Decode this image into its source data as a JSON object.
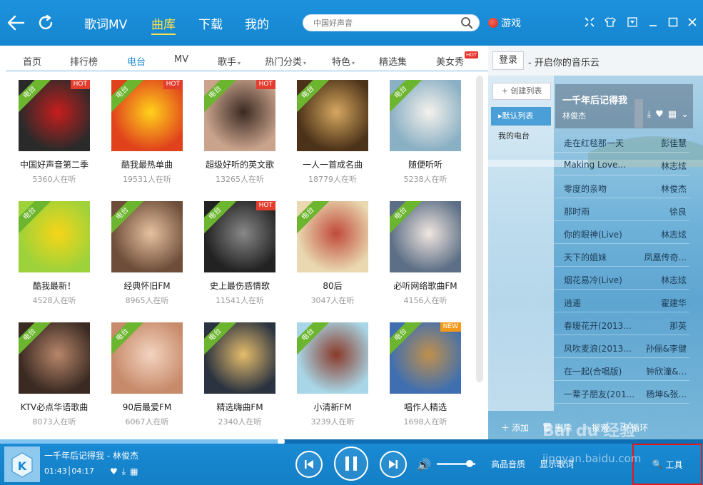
{
  "topbar": {
    "nav": [
      "歌词MV",
      "曲库",
      "下载",
      "我的"
    ],
    "active_nav": "曲库",
    "search_placeholder": "中国好声音",
    "game_label": "游戏"
  },
  "tabs": [
    {
      "label": "首页",
      "dropdown": false
    },
    {
      "label": "排行榜",
      "dropdown": false
    },
    {
      "label": "电台",
      "dropdown": false,
      "active": true
    },
    {
      "label": "MV",
      "dropdown": false
    },
    {
      "label": "歌手",
      "dropdown": true
    },
    {
      "label": "热门分类",
      "dropdown": true
    },
    {
      "label": "特色",
      "dropdown": true
    },
    {
      "label": "精选集",
      "dropdown": false
    },
    {
      "label": "美女秀",
      "dropdown": false,
      "badge": "HOT"
    }
  ],
  "stations": [
    {
      "title": "中国好声音第二季",
      "listeners": "5360人在听",
      "corner": "电台",
      "badge": "HOT",
      "bg": "#2a2a2a",
      "accent": "#c81d1d"
    },
    {
      "title": "酷我最热单曲",
      "listeners": "19531人在听",
      "corner": "电台",
      "badge": "HOT",
      "bg": "#e0421c",
      "accent": "#ffd21b"
    },
    {
      "title": "超级好听的英文歌",
      "listeners": "13265人在听",
      "corner": "电台",
      "badge": "HOT",
      "bg": "#c9a38c",
      "accent": "#3b2a22"
    },
    {
      "title": "一人一首成名曲",
      "listeners": "18779人在听",
      "corner": "电台",
      "badge": "",
      "bg": "#4b3218",
      "accent": "#d6a760"
    },
    {
      "title": "随便听听",
      "listeners": "5238人在听",
      "corner": "电台",
      "badge": "",
      "bg": "#8ab0c4",
      "accent": "#f4f1ec"
    },
    {
      "title": "酷我最新！",
      "listeners": "4528人在听",
      "corner": "电台",
      "badge": "",
      "bg": "#9dd23a",
      "accent": "#f7d518"
    },
    {
      "title": "经典怀旧FM",
      "listeners": "8965人在听",
      "corner": "电台",
      "badge": "",
      "bg": "#6e4e3a",
      "accent": "#e7c1a0"
    },
    {
      "title": "史上最伤感情歌",
      "listeners": "11541人在听",
      "corner": "电台",
      "badge": "HOT",
      "bg": "#222222",
      "accent": "#888888"
    },
    {
      "title": "80后",
      "listeners": "3047人在听",
      "corner": "电台",
      "badge": "",
      "bg": "#e9d8b0",
      "accent": "#c04a3a"
    },
    {
      "title": "必听网络歌曲FM",
      "listeners": "4156人在听",
      "corner": "电台",
      "badge": "",
      "bg": "#5d6f86",
      "accent": "#f0e6e0"
    },
    {
      "title": "KTV必点华语歌曲",
      "listeners": "8073人在听",
      "corner": "电台",
      "badge": "",
      "bg": "#3a2a22",
      "accent": "#b8866a"
    },
    {
      "title": "90后最爱FM",
      "listeners": "6067人在听",
      "corner": "电台",
      "badge": "",
      "bg": "#c78a6a",
      "accent": "#f3d4c0"
    },
    {
      "title": "精选嗨曲FM",
      "listeners": "2340人在听",
      "corner": "电台",
      "badge": "",
      "bg": "#2b3340",
      "accent": "#e6bd6c"
    },
    {
      "title": "小清新FM",
      "listeners": "3239人在听",
      "corner": "电台",
      "badge": "",
      "bg": "#a8d6e6",
      "accent": "#8a3a2a"
    },
    {
      "title": "唱作人精选",
      "listeners": "1698人在听",
      "corner": "电台",
      "badge": "NEW",
      "bg": "#3f6fb0",
      "accent": "#c0904c"
    }
  ],
  "right": {
    "login": "登录",
    "login_tip": "- 开启你的音乐云",
    "create_list": "+ 创建列表",
    "playlists": [
      {
        "label": "▸默认列表",
        "active": true
      },
      {
        "label": "我的电台",
        "active": false
      }
    ],
    "now_playing": {
      "title": "一千年后记得我",
      "artist": "林俊杰"
    },
    "songs": [
      {
        "name": "走在红毯那一天",
        "artist": "彭佳慧"
      },
      {
        "name": "Making Love...",
        "artist": "林志炫"
      },
      {
        "name": "零度的亲吻",
        "artist": "林俊杰"
      },
      {
        "name": "那时雨",
        "artist": "徐良"
      },
      {
        "name": "你的眼神(Live)",
        "artist": "林志炫"
      },
      {
        "name": "天下的姐妹",
        "artist": "凤凰传奇..."
      },
      {
        "name": "烟花易冷(Live)",
        "artist": "林志炫"
      },
      {
        "name": "逍遥",
        "artist": "霍建华"
      },
      {
        "name": "春暖花开(2013...",
        "artist": "那英"
      },
      {
        "name": "风吹麦浪(2013...",
        "artist": "孙俪&李健"
      },
      {
        "name": "在一起(合唱版)",
        "artist": "钟欣潼&..."
      },
      {
        "name": "一辈子朋友(201...",
        "artist": "杨坤&张..."
      }
    ],
    "footer": [
      "添加",
      "删除",
      "搜索",
      "循环"
    ]
  },
  "player": {
    "title": "一千年后记得我 - 林俊杰",
    "time": "01:43│04:17",
    "progress": 0.4,
    "volume": 0.85,
    "quality": "高品音质",
    "lyric": "显示歌词",
    "tools": "工具",
    "watermark": "Bai du 经验",
    "watermark_url": "jingyan.baidu.com"
  }
}
